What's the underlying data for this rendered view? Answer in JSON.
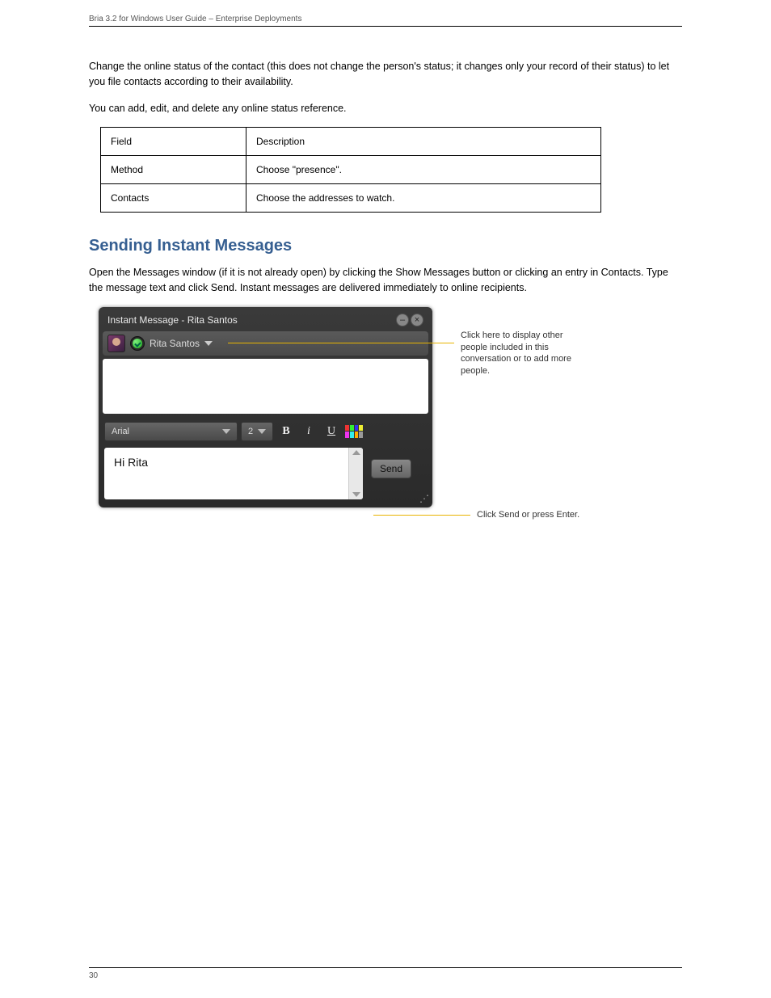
{
  "header": {
    "left": "Bria 3.2 for Windows User Guide – Enterprise Deployments",
    "right": ""
  },
  "paragraphs": {
    "p1": "Change the online status of the contact (this does not change the person's status; it changes only your record of their status) to let you file contacts according to their availability.",
    "p2": "You can add, edit, and delete any online status reference."
  },
  "table": {
    "rows": [
      {
        "c1": "Field",
        "c2": "Description"
      },
      {
        "c1": "Method",
        "c2": "Choose \"presence\"."
      },
      {
        "c1": "Contacts",
        "c2": "Choose the addresses to watch."
      }
    ]
  },
  "section_heading": "Sending Instant Messages",
  "section_text": "Open the Messages window (if it is not already open) by clicking the Show Messages button or clicking an entry in Contacts. Type the message text and click Send. Instant messages are delivered immediately to online recipients.",
  "im": {
    "title": "Instant Message - Rita Santos",
    "contact_name": "Rita Santos",
    "font": "Arial",
    "size": "2",
    "bold": "B",
    "italic": "i",
    "underline": "U",
    "input_text": "Hi Rita",
    "send_label": "Send"
  },
  "callouts": {
    "top": "Click here to display other people included in this conversation or to add more people.",
    "bottom": "Click Send or press Enter."
  },
  "followup_heading": "",
  "footer": {
    "left": "30",
    "right": ""
  }
}
